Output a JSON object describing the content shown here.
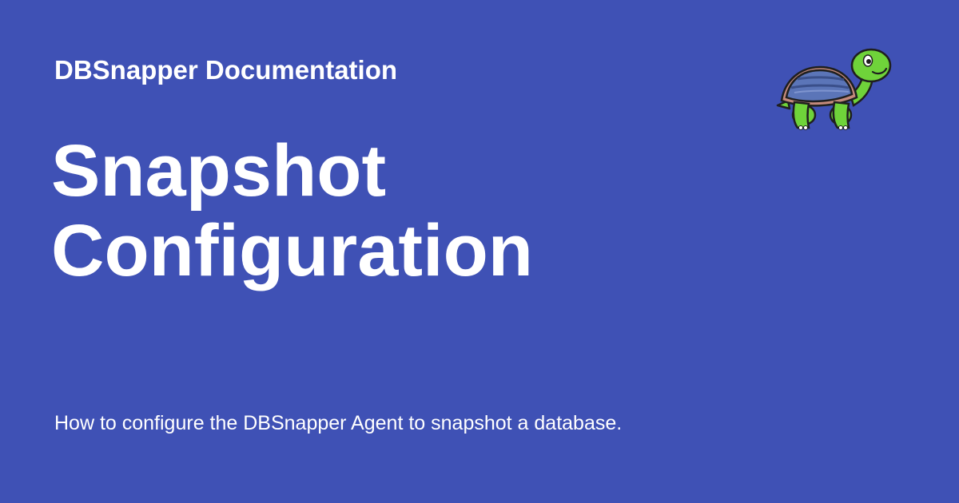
{
  "site": {
    "name": "DBSnapper Documentation"
  },
  "page": {
    "title_line1": "Snapshot",
    "title_line2": "Configuration",
    "description": "How to configure the DBSnapper Agent to snapshot a database."
  },
  "logo": {
    "icon": "turtle-icon"
  },
  "colors": {
    "background": "#3f51b5",
    "text": "#ffffff",
    "turtle_skin": "#6fd33a",
    "turtle_shell": "#5b75b8",
    "shell_rim": "#c48a7c"
  }
}
